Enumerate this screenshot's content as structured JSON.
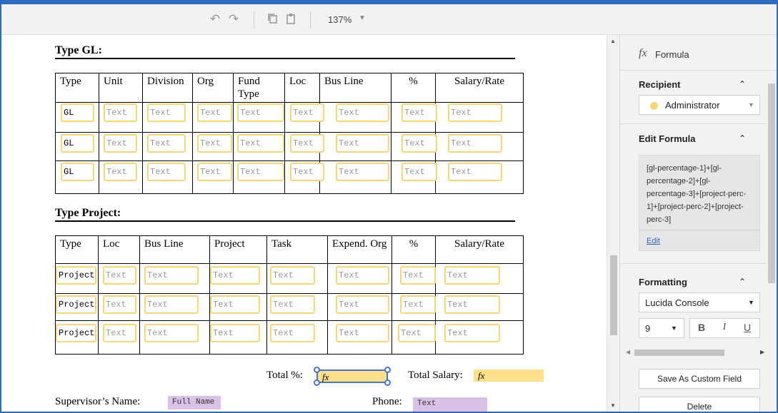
{
  "toolbar": {
    "undo_icon": "undo-icon",
    "redo_icon": "redo-icon",
    "copy_icon": "copy-icon",
    "paste_icon": "paste-icon",
    "zoom": "137%"
  },
  "document": {
    "gl_title": "Type GL:",
    "gl_headers": [
      "Type",
      "Unit",
      "Division",
      "Org",
      "Fund Type",
      "Loc",
      "Bus Line",
      "%",
      "Salary/Rate"
    ],
    "gl_rows": [
      [
        "GL",
        "Text",
        "Text",
        "Text",
        "Text",
        "Text",
        "Text",
        "Text",
        "Text"
      ],
      [
        "GL",
        "Text",
        "Text",
        "Text",
        "Text",
        "Text",
        "Text",
        "Text",
        "Text"
      ],
      [
        "GL",
        "Text",
        "Text",
        "Text",
        "Text",
        "Text",
        "Text",
        "Text",
        "Text"
      ]
    ],
    "project_title": "Type Project:",
    "project_headers": [
      "Type",
      "Loc",
      "Bus Line",
      "Project",
      "Task",
      "Expend. Org",
      "%",
      "Salary/Rate"
    ],
    "project_rows": [
      [
        "Project",
        "Text",
        "Text",
        "Text",
        "Text",
        "Text",
        "Text",
        "Text"
      ],
      [
        "Project",
        "Text",
        "Text",
        "Text",
        "Text",
        "Text",
        "Text",
        "Text"
      ],
      [
        "Project",
        "Text",
        "Text",
        "Text",
        "Text",
        "Text",
        "Text",
        "Text"
      ]
    ],
    "total_pct_label": "Total %:",
    "total_pct_fx": "fx",
    "total_salary_label": "Total Salary:",
    "total_salary_fx": "fx",
    "supervisor_label": "Supervisor’s Name:",
    "supervisor_field": "Full Name",
    "phone_label": "Phone:",
    "phone_field": "Text"
  },
  "panel": {
    "header_icon": "fx",
    "header_title": "Formula",
    "recipient_title": "Recipient",
    "recipient_value": "Administrator",
    "edit_formula_title": "Edit Formula",
    "formula_text": "[gl-percentage-1]+[gl-percentage-2]+[gl-percentage-3]+[project-perc-1]+[project-perc-2]+[project-perc-3]",
    "edit_link": "Edit",
    "formatting_title": "Formatting",
    "font_value": "Lucida Console",
    "size_value": "9",
    "bold": "B",
    "italic": "I",
    "underline": "U",
    "save_custom_field": "Save As Custom Field",
    "delete": "Delete"
  },
  "colors": {
    "field_border": "#f7d67a",
    "selection": "#4a74c9",
    "formula_fill": "#ffe08a",
    "purple_field": "#d9c2e6",
    "accent": "#2f6bbf"
  }
}
